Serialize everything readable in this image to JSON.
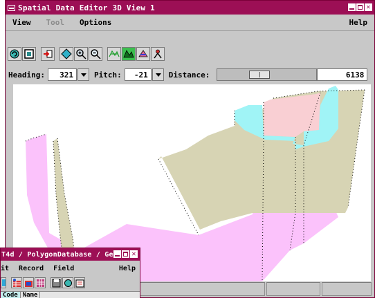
{
  "main_window": {
    "title": "Spatial Data Editor 3D View 1",
    "menus": [
      {
        "label": "View",
        "enabled": true
      },
      {
        "label": "Tool",
        "enabled": false
      },
      {
        "label": "Options",
        "enabled": true
      }
    ],
    "help": "Help",
    "close_glyph": "✕",
    "toolbar_icons": [
      "refresh-icon",
      "window-icon",
      "add-object-icon",
      "diamond-icon",
      "zoom-in-icon",
      "zoom-out-icon",
      "wireframe-icon",
      "surface-icon",
      "layers-icon",
      "person-icon"
    ],
    "view_controls": {
      "heading_label": "Heading:",
      "heading_value": "321",
      "pitch_label": "Pitch:",
      "pitch_value": "-21",
      "distance_label": "Distance:",
      "distance_value": "6138",
      "distance_slider_fraction": 0.4
    }
  },
  "db_window": {
    "title": "T4d / PolygonDatabase / Ge",
    "menus": [
      "it",
      "Record",
      "Field"
    ],
    "help": "Help",
    "columns": [
      "Code",
      "Name"
    ]
  },
  "colors": {
    "title_bar": "#9c0f55",
    "window_bg": "#c8c8c8",
    "polygon_pink": "#fbc2fb",
    "polygon_tan": "#d7d4b4",
    "polygon_cyan": "#a0f4f6",
    "polygon_rose": "#f9cfd3"
  }
}
